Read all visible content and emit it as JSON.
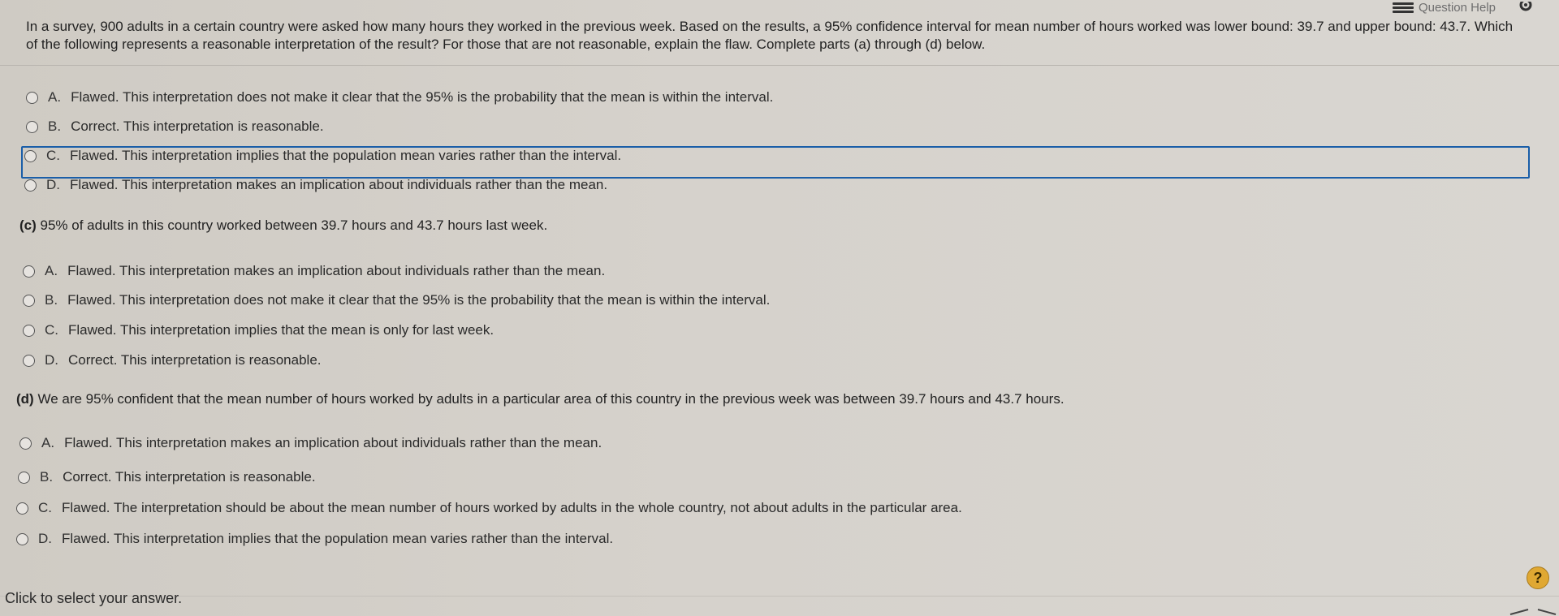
{
  "header": {
    "help_label": "Question Help"
  },
  "question": {
    "text": "In a survey, 900 adults in a certain country were asked how many hours they worked in the previous week. Based on the results, a 95% confidence interval for mean number of hours worked was lower bound: 39.7 and upper bound: 43.7. Which of the following represents a reasonable interpretation of the result? For those that are not reasonable, explain the flaw. Complete parts (a) through (d) below."
  },
  "part_b": {
    "options": [
      {
        "letter": "A.",
        "text": "Flawed. This interpretation does not make it clear that the 95% is the probability that the mean is within the interval."
      },
      {
        "letter": "B.",
        "text": "Correct. This interpretation is reasonable."
      },
      {
        "letter": "C.",
        "text": "Flawed. This interpretation implies that the population mean varies rather than the interval."
      },
      {
        "letter": "D.",
        "text": "Flawed. This interpretation makes an implication about individuals rather than the mean."
      }
    ]
  },
  "part_c": {
    "label": "(c)",
    "statement": "95% of adults in this country worked between 39.7 hours and 43.7 hours last week.",
    "options": [
      {
        "letter": "A.",
        "text": "Flawed. This interpretation makes an implication about individuals rather than the mean."
      },
      {
        "letter": "B.",
        "text": "Flawed. This interpretation does not make it clear that the 95% is the probability that the mean is within the interval."
      },
      {
        "letter": "C.",
        "text": "Flawed. This interpretation implies that the mean is only for last week."
      },
      {
        "letter": "D.",
        "text": "Correct. This interpretation is reasonable."
      }
    ]
  },
  "part_d": {
    "label": "(d)",
    "statement": "We are 95% confident that the mean number of hours worked by adults in a particular area of this country in the previous week was between 39.7 hours and 43.7 hours.",
    "options": [
      {
        "letter": "A.",
        "text": "Flawed. This interpretation makes an implication about individuals rather than the mean."
      },
      {
        "letter": "B.",
        "text": "Correct. This interpretation is reasonable."
      },
      {
        "letter": "C.",
        "text": "Flawed. The interpretation should be about the mean number of hours worked by adults in the whole country, not about adults in the particular area."
      },
      {
        "letter": "D.",
        "text": "Flawed. This interpretation implies that the population mean varies rather than the interval."
      }
    ]
  },
  "footer": {
    "instruction": "Click to select your answer.",
    "help_symbol": "?"
  },
  "colors": {
    "selection_border": "#1a5ea8",
    "help_circle": "#e0a832"
  }
}
